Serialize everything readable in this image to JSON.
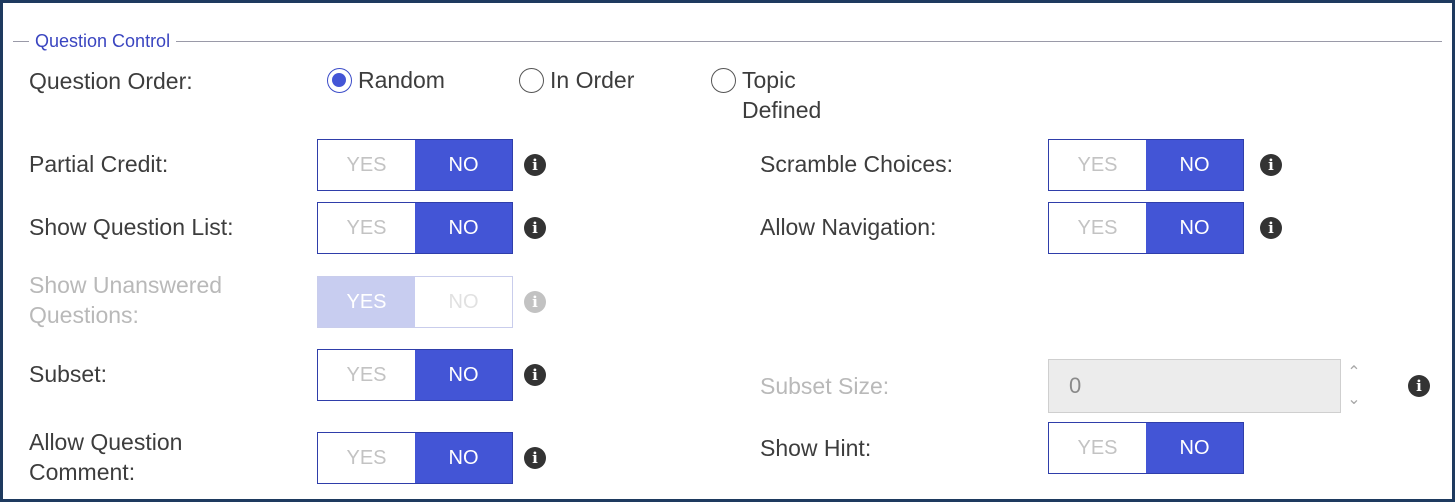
{
  "section": {
    "title": "Question Control"
  },
  "question_order": {
    "label": "Question Order:",
    "options": [
      {
        "label": "Random",
        "checked": true
      },
      {
        "label": "In Order",
        "checked": false
      },
      {
        "label_line1": "Topic",
        "label_line2": "Defined",
        "checked": false
      }
    ]
  },
  "toggle_labels": {
    "yes": "YES",
    "no": "NO"
  },
  "partial_credit": {
    "label": "Partial Credit:",
    "value": "NO"
  },
  "scramble_choices": {
    "label": "Scramble Choices:",
    "value": "NO"
  },
  "show_question_list": {
    "label": "Show Question List:",
    "value": "NO"
  },
  "allow_navigation": {
    "label": "Allow Navigation:",
    "value": "NO"
  },
  "show_unanswered": {
    "label_line1": "Show Unanswered",
    "label_line2": "Questions:",
    "value": "YES",
    "disabled": true
  },
  "subset": {
    "label": "Subset:",
    "value": "NO"
  },
  "subset_size": {
    "label": "Subset Size:",
    "value": "0",
    "disabled": true
  },
  "allow_question_comment": {
    "label_line1": "Allow Question",
    "label_line2": "Comment:",
    "value": "NO"
  },
  "show_hint": {
    "label": "Show Hint:",
    "value": "NO"
  },
  "icons": {
    "info": "info-icon",
    "spinner_up": "chevron-up-icon",
    "spinner_down": "chevron-down-icon"
  },
  "colors": {
    "accent": "#4355d6",
    "border": "#1e3a5f",
    "legend": "#3a45c0"
  }
}
